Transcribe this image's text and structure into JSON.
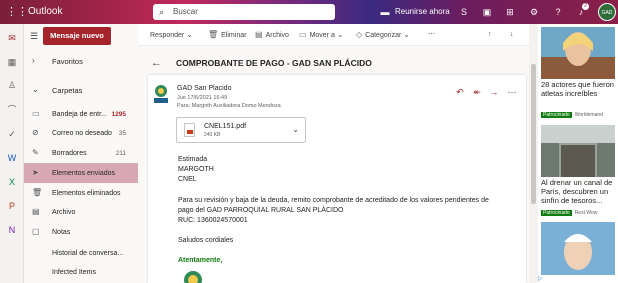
{
  "app": {
    "name": "Outlook",
    "launcher_icon": "app-launcher-icon"
  },
  "search": {
    "placeholder": "Buscar"
  },
  "header": {
    "meet_label": "Reunirse ahora",
    "notification_count": "2",
    "avatar_text": "GAD"
  },
  "nav": {
    "new_message": "Mensaje nuevo",
    "favorites": "Favoritos",
    "folders": "Carpetas",
    "items": [
      {
        "label": "Bandeja de entr...",
        "count": "1295",
        "icon": "inbox-icon"
      },
      {
        "label": "Correo no deseado",
        "count": "35",
        "icon": "junk-icon"
      },
      {
        "label": "Borradores",
        "count": "211",
        "icon": "drafts-icon"
      },
      {
        "label": "Elementos enviados",
        "count": "",
        "icon": "sent-icon"
      },
      {
        "label": "Elementos eliminados",
        "count": "",
        "icon": "trash-icon"
      },
      {
        "label": "Archivo",
        "count": "",
        "icon": "archive-icon"
      },
      {
        "label": "Notas",
        "count": "",
        "icon": "notes-icon"
      },
      {
        "label": "Historial de conversa...",
        "count": "",
        "icon": ""
      },
      {
        "label": "Infected Items",
        "count": "",
        "icon": ""
      }
    ]
  },
  "toolbar": {
    "reply": "Responder",
    "delete": "Eliminar",
    "archive": "Archivo",
    "move": "Mover a",
    "categorize": "Categorizar"
  },
  "message": {
    "subject": "COMPROBANTE DE PAGO - GAD SAN PLÁCIDO",
    "sender": "GAD San Placido",
    "date": "Jue 17/6/2021 16:49",
    "to_label": "Para:",
    "to": "Margoth Auxiliadora Domo Mendoza",
    "attachment": {
      "name": "CNEL151.pdf",
      "size": "240 KB"
    },
    "body": {
      "l1": "Estimada",
      "l2": "MARGOTH",
      "l3": "CNEL",
      "l4": "Para su revisión y baja de la deuda, remito comprobante de acreditado de los valores pendientes de",
      "l5": "pago del GAD PARROQUIAL RURAL SAN PLÁCIDO",
      "l6": " RUC: 1360024570001",
      "l7": "Saludos cordiales",
      "l8": "Atentamente,"
    }
  },
  "ads": [
    {
      "text": "28 actores que fueron atletas increíbles",
      "sponsored": "Patrocinado",
      "source": "Worldemand"
    },
    {
      "text": "Al drenar un canal de París, descubren un sinfín de tesoros...",
      "sponsored": "Patrocinado",
      "source": "Rest Wow"
    }
  ],
  "colors": {
    "brand": "#a4262c",
    "selected": "#d8a9b4",
    "sponsor": "#107c10"
  }
}
